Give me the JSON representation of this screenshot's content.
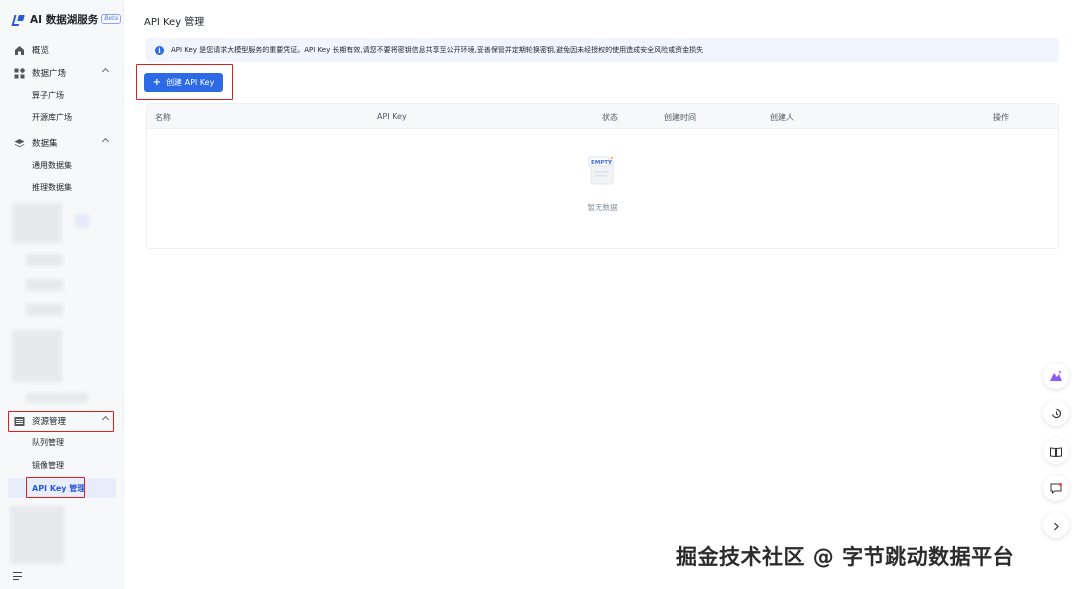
{
  "app": {
    "title": "AI 数据湖服务",
    "badge": "Beta"
  },
  "sidebar": {
    "overview": "概览",
    "data_square": "数据广场",
    "data_square_items": [
      "算子广场",
      "开源库广场"
    ],
    "datasets": "数据集",
    "datasets_items": [
      "通用数据集",
      "推理数据集"
    ],
    "resource_mgmt": "资源管理",
    "resource_items": [
      "队列管理",
      "镜像管理",
      "API Key 管理"
    ],
    "active_item": "API Key 管理"
  },
  "page": {
    "title": "API Key 管理",
    "notice": "API Key 是您请求大模型服务的重要凭证。API Key 长期有效,请您不要将密钥信息共享至公开环境,妥善保管并定期轮换密钥,避免因未经授权的使用造成安全风险或资金损失",
    "create_button": "创建 API Key"
  },
  "table": {
    "columns": [
      "名称",
      "API Key",
      "状态",
      "创建时间",
      "创建人",
      "操作"
    ],
    "rows": [],
    "empty_text": "暂无数据",
    "empty_icon_label": "EMPTY"
  },
  "watermark": "掘金技术社区 @ 字节跳动数据平台",
  "colors": {
    "accent": "#2d6ae6",
    "highlight": "#e02020",
    "sidebar_bg": "#f7f8fa"
  },
  "icons": [
    "home-icon",
    "grid-icon",
    "layers-icon",
    "server-icon",
    "info-icon",
    "plus-icon",
    "empty-box-icon",
    "assistant-icon",
    "refresh-icon",
    "book-icon",
    "feedback-icon",
    "chevron-right-icon",
    "collapse-menu-icon"
  ]
}
